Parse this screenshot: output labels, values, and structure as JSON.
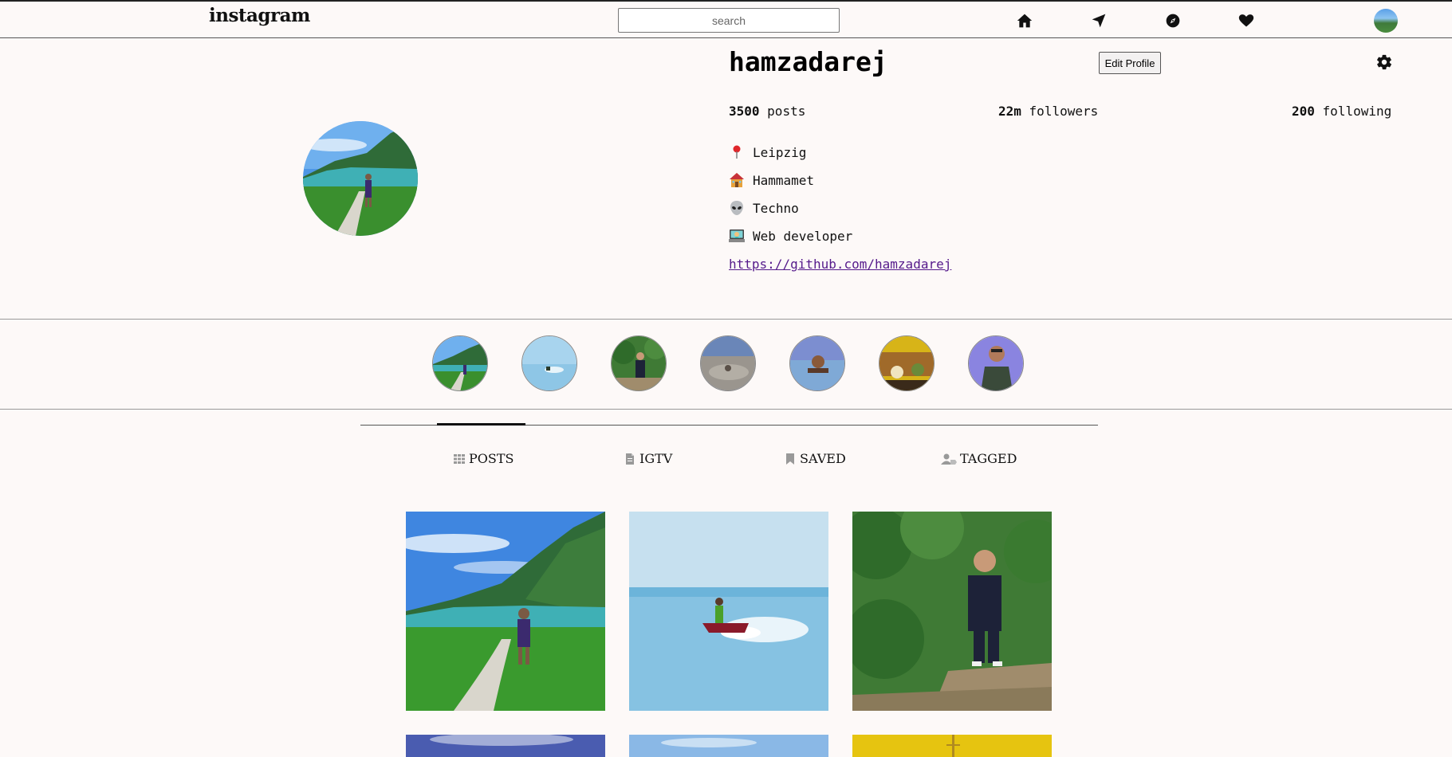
{
  "header": {
    "logo": "instagram",
    "search_placeholder": "search",
    "nav": [
      "home-icon",
      "send-icon",
      "explore-icon",
      "heart-icon"
    ]
  },
  "profile": {
    "username": "hamzadarej",
    "edit_label": "Edit Profile",
    "stats": {
      "posts_count": "3500",
      "posts_label": "posts",
      "followers_count": "22m",
      "followers_label": "followers",
      "following_count": "200",
      "following_label": "following"
    },
    "bio": [
      {
        "icon": "pin-icon",
        "text": "Leipzig"
      },
      {
        "icon": "house-icon",
        "text": "Hammamet"
      },
      {
        "icon": "alien-icon",
        "text": "Techno"
      },
      {
        "icon": "technologist-icon",
        "text": "Web developer"
      }
    ],
    "link": "https://github.com/hamzadarej"
  },
  "tabs": [
    {
      "label": "POSTS",
      "icon": "grid-icon",
      "active": true
    },
    {
      "label": "IGTV",
      "icon": "tv-icon",
      "active": false
    },
    {
      "label": "SAVED",
      "icon": "bookmark-icon",
      "active": false
    },
    {
      "label": "TAGGED",
      "icon": "tag-user-icon",
      "active": false
    }
  ],
  "colors": {
    "background": "#fdf9f8",
    "link": "#551a8b",
    "text": "#111111"
  }
}
